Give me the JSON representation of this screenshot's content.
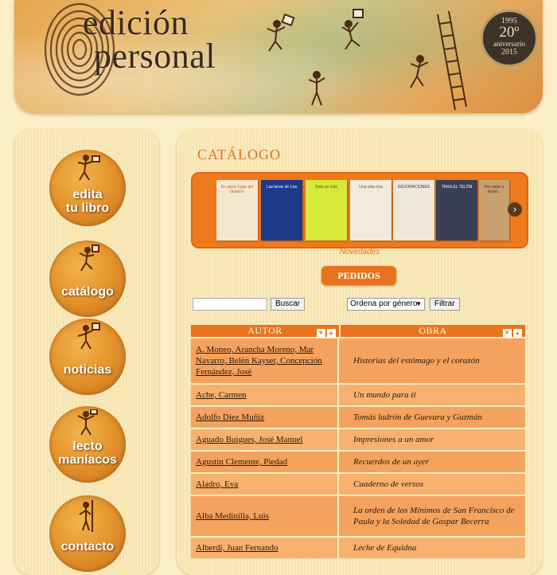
{
  "header": {
    "brand_line1": "edición",
    "brand_line2": "personal",
    "badge": {
      "year_start": "1995",
      "big": "20º",
      "label": "aniversario",
      "year_end": "2015"
    }
  },
  "sidebar": {
    "items": [
      {
        "label_l1": "edita",
        "label_l2": "tu libro",
        "icon": "reader-figure-icon"
      },
      {
        "label_l1": "catálogo",
        "label_l2": "",
        "icon": "runner-figure-icon"
      },
      {
        "label_l1": "noticias",
        "label_l2": "",
        "icon": "announcer-figure-icon"
      },
      {
        "label_l1": "lecto",
        "label_l2": "maníacos",
        "icon": "juggler-figure-icon"
      },
      {
        "label_l1": "contacto",
        "label_l2": "",
        "icon": "staff-figure-icon"
      }
    ]
  },
  "main": {
    "title": "CATÁLOGO",
    "carousel": {
      "books": [
        {
          "title": "En algún lugar del desierto",
          "bg": "#f3e7cf",
          "fg": "#c0602a"
        },
        {
          "title": "Las lunas de Lira",
          "bg": "#1d3a8a",
          "fg": "#ffffff"
        },
        {
          "title": "Todo es todo",
          "bg": "#d7e83a",
          "fg": "#4a5a10"
        },
        {
          "title": "Una vida mía",
          "bg": "#f3eadf",
          "fg": "#7a4a2a"
        },
        {
          "title": "DEVORACIONES",
          "bg": "#efe6dc",
          "fg": "#4a2a1a"
        },
        {
          "title": "TRAS EL TELÓN",
          "bg": "#3a3f55",
          "fg": "#ffffff"
        },
        {
          "title": "Por amor e incert...",
          "bg": "#c8a070",
          "fg": "#5a2a10"
        }
      ],
      "next_arrow": "›",
      "caption": "Novedades"
    },
    "pedidos_label": "PEDIDOS",
    "search": {
      "placeholder": "",
      "button": "Buscar"
    },
    "filter": {
      "selected": "Ordena por género",
      "button": "Filtrar"
    },
    "table": {
      "headers": {
        "autor": "AUTOR",
        "obra": "OBRA"
      },
      "rows": [
        {
          "autor": "A. Moneo, Arancha Moreno, Mar Navarro, Belén Kayser, Concepción Fernández, José",
          "obra": "Historias del estómago y el corazón"
        },
        {
          "autor": "Ache, Carmen",
          "obra": "Un mundo para ti"
        },
        {
          "autor": "Adolfo Díez Muñiz",
          "obra": "Tomás ladrón de Guevara y Guzmán"
        },
        {
          "autor": "Aguado Buigues, José Manuel",
          "obra": "Impresiones a un amor"
        },
        {
          "autor": "Agustín Clemente, Piedad",
          "obra": "Recuerdos de un ayer"
        },
        {
          "autor": "Aladro, Eva",
          "obra": "Cuaderno de versos"
        },
        {
          "autor": "Alba Medinilla, Luis",
          "obra": "La orden de los Mínimos de San Francisco de Paula y la Soledad de Gaspar Becerra"
        },
        {
          "autor": "Alberdi, Juan Fernando",
          "obra": "Leche de Equidna"
        }
      ]
    }
  }
}
